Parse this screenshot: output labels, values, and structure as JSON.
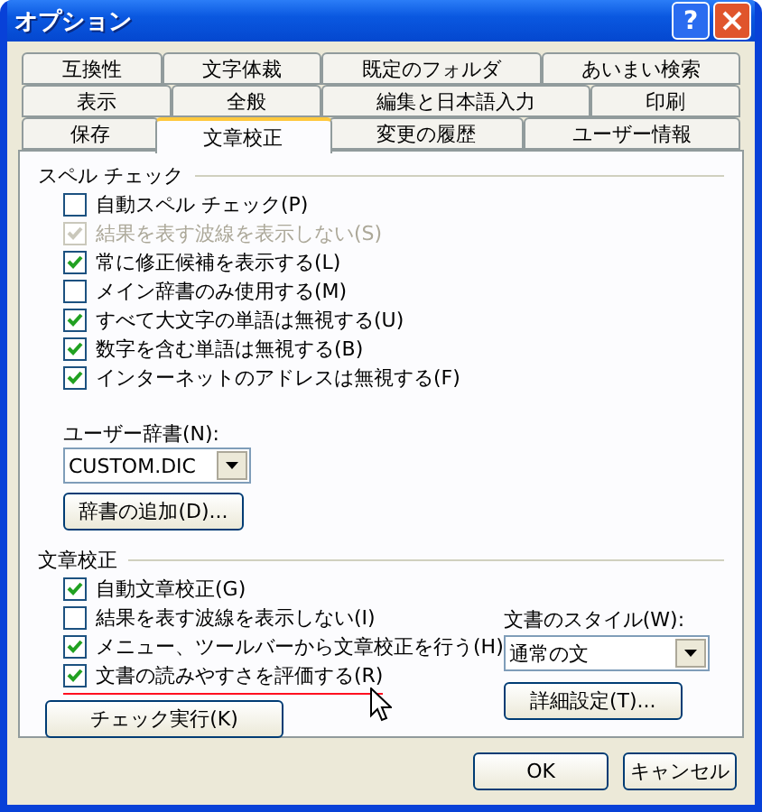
{
  "window": {
    "title": "オプション",
    "help_button": "?"
  },
  "tab_rows": [
    [
      {
        "label": "互換性",
        "selected": false
      },
      {
        "label": "文字体裁",
        "selected": false
      },
      {
        "label": "既定のフォルダ",
        "selected": false
      },
      {
        "label": "あいまい検索",
        "selected": false
      }
    ],
    [
      {
        "label": "表示",
        "selected": false
      },
      {
        "label": "全般",
        "selected": false
      },
      {
        "label": "編集と日本語入力",
        "selected": false
      },
      {
        "label": "印刷",
        "selected": false
      }
    ],
    [
      {
        "label": "保存",
        "selected": false
      },
      {
        "label": "文章校正",
        "selected": true
      },
      {
        "label": "変更の履歴",
        "selected": false
      },
      {
        "label": "ユーザー情報",
        "selected": false
      }
    ]
  ],
  "spelling": {
    "title": "スペル チェック",
    "options": [
      {
        "label": "自動スペル チェック(P)",
        "checked": false,
        "disabled": false
      },
      {
        "label": "結果を表す波線を表示しない(S)",
        "checked": true,
        "disabled": true
      },
      {
        "label": "常に修正候補を表示する(L)",
        "checked": true,
        "disabled": false
      },
      {
        "label": "メイン辞書のみ使用する(M)",
        "checked": false,
        "disabled": false
      },
      {
        "label": "すべて大文字の単語は無視する(U)",
        "checked": true,
        "disabled": false
      },
      {
        "label": "数字を含む単語は無視する(B)",
        "checked": true,
        "disabled": false
      },
      {
        "label": "インターネットのアドレスは無視する(F)",
        "checked": true,
        "disabled": false
      }
    ],
    "dictionary_label": "ユーザー辞書(N):",
    "dictionary_value": "CUSTOM.DIC",
    "add_button": "辞書の追加(D)..."
  },
  "grammar": {
    "title": "文章校正",
    "options": [
      {
        "label": "自動文章校正(G)",
        "checked": true,
        "disabled": false,
        "highlighted": false
      },
      {
        "label": "結果を表す波線を表示しない(I)",
        "checked": false,
        "disabled": false,
        "highlighted": false
      },
      {
        "label": "メニュー、ツールバーから文章校正を行う(H)",
        "checked": true,
        "disabled": false,
        "highlighted": false
      },
      {
        "label": "文書の読みやすさを評価する(R)",
        "checked": true,
        "disabled": false,
        "highlighted": true
      }
    ],
    "check_button": "チェック実行(K)",
    "style_label": "文書のスタイル(W):",
    "style_value": "通常の文",
    "settings_button": "詳細設定(T)..."
  },
  "buttons": [
    "OK",
    "キャンセル"
  ]
}
